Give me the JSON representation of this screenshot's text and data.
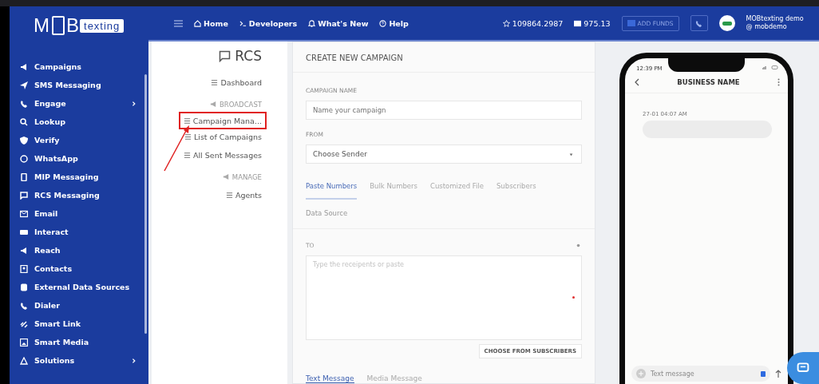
{
  "sidebar": {
    "logo": {
      "left": "M",
      "middle": "B",
      "badge": "texting"
    },
    "items": [
      {
        "label": "Campaigns",
        "expandable": false
      },
      {
        "label": "SMS Messaging",
        "expandable": false
      },
      {
        "label": "Engage",
        "expandable": true
      },
      {
        "label": "Lookup",
        "expandable": false
      },
      {
        "label": "Verify",
        "expandable": false
      },
      {
        "label": "WhatsApp",
        "expandable": false
      },
      {
        "label": "MIP Messaging",
        "expandable": false
      },
      {
        "label": "RCS Messaging",
        "expandable": false
      },
      {
        "label": "Email",
        "expandable": false
      },
      {
        "label": "Interact",
        "expandable": false
      },
      {
        "label": "Reach",
        "expandable": false
      },
      {
        "label": "Contacts",
        "expandable": false
      },
      {
        "label": "External Data Sources",
        "expandable": false
      },
      {
        "label": "Dialer",
        "expandable": false
      },
      {
        "label": "Smart Link",
        "expandable": false
      },
      {
        "label": "Smart Media",
        "expandable": false
      },
      {
        "label": "Solutions",
        "expandable": true
      }
    ]
  },
  "topbar": {
    "links": [
      "Home",
      "Developers",
      "What's New",
      "Help"
    ],
    "credits": "109864.2987",
    "balance": "975.13",
    "add_funds": "ADD FUNDS",
    "user": {
      "name": "MOBtexting demo",
      "handle": "@ mobdemo"
    }
  },
  "submenu": {
    "title": "RCS",
    "items": [
      {
        "kind": "link",
        "label": "Dashboard",
        "highlighted": false
      },
      {
        "kind": "section",
        "label": "BROADCAST",
        "highlighted": false
      },
      {
        "kind": "link",
        "label": "Campaign Mana...",
        "highlighted": true
      },
      {
        "kind": "link",
        "label": "List of Campaigns",
        "highlighted": false
      },
      {
        "kind": "link",
        "label": "All Sent Messages",
        "highlighted": false
      },
      {
        "kind": "section",
        "label": "MANAGE",
        "highlighted": false
      },
      {
        "kind": "link",
        "label": "Agents",
        "highlighted": false
      }
    ]
  },
  "form": {
    "title": "CREATE NEW CAMPAIGN",
    "name_label": "CAMPAIGN NAME",
    "name_placeholder": "Name your campaign",
    "from_label": "FROM",
    "from_value": "Choose Sender",
    "recipient_tabs": [
      {
        "label": "Paste Numbers",
        "selected": true
      },
      {
        "label": "Bulk Numbers",
        "selected": false
      },
      {
        "label": "Customized File",
        "selected": false
      },
      {
        "label": "Subscribers",
        "selected": false
      }
    ],
    "data_source": "Data Source",
    "to_label": "TO",
    "to_placeholder": "Type the receipents or paste",
    "choose_button": "CHOOSE FROM SUBSCRIBERS",
    "message_tabs": [
      {
        "label": "Text Message",
        "selected": true
      },
      {
        "label": "Media Message",
        "selected": false
      }
    ]
  },
  "phone": {
    "time": "12:39 PM",
    "business_name": "BUSINESS NAME",
    "timestamp": "27-01 04:07 AM",
    "input_placeholder": "Text message"
  }
}
